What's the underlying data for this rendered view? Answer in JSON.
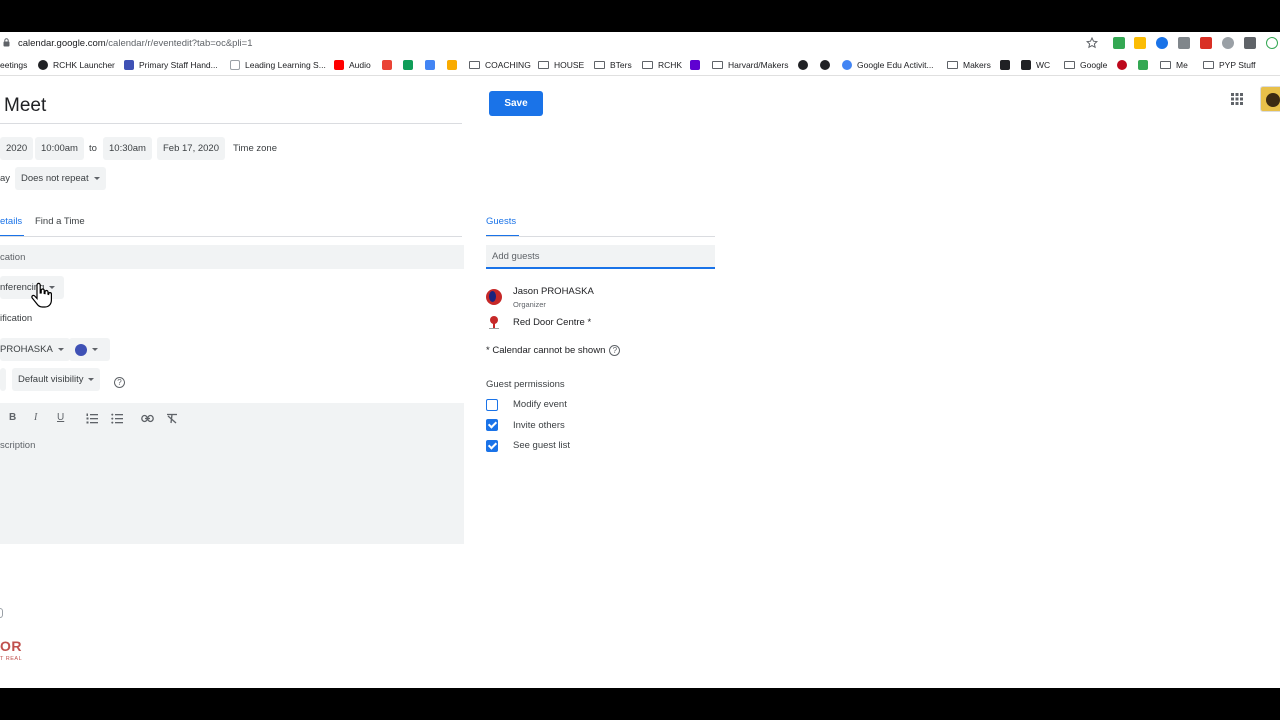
{
  "browser": {
    "url_main": "calendar.google.com",
    "url_path": "/calendar/r/eventedit?tab=oc&pli=1",
    "bookmarks": [
      {
        "label": "eetings",
        "icon": "none"
      },
      {
        "label": "RCHK Launcher",
        "icon": "launcher-icon"
      },
      {
        "label": "Primary Staff Hand...",
        "icon": "page-icon"
      },
      {
        "label": "Leading Learning S...",
        "icon": "doc-icon"
      },
      {
        "label": "Audio",
        "icon": "youtube-icon"
      },
      {
        "label": "",
        "icon": "gmail-icon"
      },
      {
        "label": "",
        "icon": "drive-icon"
      },
      {
        "label": "",
        "icon": "calendar-icon"
      },
      {
        "label": "",
        "icon": "classroom-icon"
      },
      {
        "label": "COACHING",
        "icon": "folder-icon"
      },
      {
        "label": "HOUSE",
        "icon": "folder-icon"
      },
      {
        "label": "BTers",
        "icon": "folder-icon"
      },
      {
        "label": "RCHK",
        "icon": "folder-icon"
      },
      {
        "label": "",
        "icon": "yahoo-icon"
      },
      {
        "label": "Harvard/Makers",
        "icon": "folder-icon"
      },
      {
        "label": "",
        "icon": "apple-icon"
      },
      {
        "label": "",
        "icon": "apple-icon"
      },
      {
        "label": "Google Edu Activit...",
        "icon": "google-icon"
      },
      {
        "label": "Makers",
        "icon": "folder-icon"
      },
      {
        "label": "",
        "icon": "w-icon"
      },
      {
        "label": "WC",
        "icon": "w-icon"
      },
      {
        "label": "Google",
        "icon": "folder-icon"
      },
      {
        "label": "",
        "icon": "pinterest-icon"
      },
      {
        "label": "",
        "icon": "puzzle-icon"
      },
      {
        "label": "Me",
        "icon": "folder-icon"
      },
      {
        "label": "PYP Stuff",
        "icon": "folder-icon"
      }
    ]
  },
  "event": {
    "title": "Meet",
    "save_label": "Save",
    "start_date": "2020",
    "start_time": "10:00am",
    "to_label": "to",
    "end_time": "10:30am",
    "end_date": "Feb 17, 2020",
    "timezone_label": "Time zone",
    "allday_label": "ay",
    "repeat": "Does not repeat"
  },
  "tabs": {
    "details": "etails",
    "find_time": "Find a Time",
    "guests": "Guests"
  },
  "details": {
    "location_placeholder": "cation",
    "conferencing_label": "nferencing",
    "notification_label": "ification",
    "calendar_owner": "PROHASKA",
    "visibility": "Default visibility",
    "description_placeholder": "scription",
    "toolbar": [
      "B",
      "I",
      "U"
    ]
  },
  "guests": {
    "add_placeholder": "Add guests",
    "list": [
      {
        "name": "Jason PROHASKA",
        "role": "Organizer"
      },
      {
        "name": "Red Door Centre *",
        "role": ""
      }
    ],
    "calendar_note": "* Calendar cannot be shown",
    "permissions_title": "Guest permissions",
    "permissions": [
      {
        "label": "Modify event",
        "checked": false
      },
      {
        "label": "Invite others",
        "checked": true
      },
      {
        "label": "See guest list",
        "checked": true
      }
    ]
  },
  "footer": {
    "logo_text": "OR",
    "logo_sub": "T REAL"
  },
  "colors": {
    "accent": "#1a73e8",
    "event_color": "#3f51b5"
  }
}
